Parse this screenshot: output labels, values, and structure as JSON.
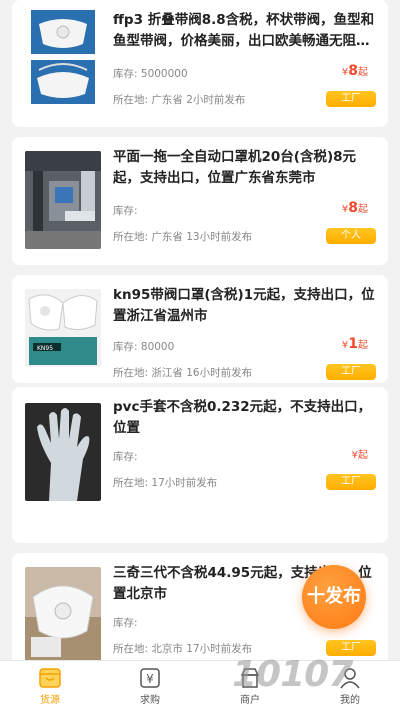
{
  "listings": [
    {
      "title": "ffp3 折叠带阀8.8含税，杯状带阀，鱼型和鱼型带阀，价格美丽，出口欧美畅通无阻…",
      "stock_label": "库存:",
      "stock_value": "5000000",
      "price_symbol": "¥",
      "price_value": "8",
      "price_suffix": "起",
      "location_label": "所在地:",
      "location_value": "广东省 2小时前发布",
      "tag": "工厂"
    },
    {
      "title": "平面一拖一全自动口罩机20台(含税)8元起，支持出口，位置广东省东莞市",
      "stock_label": "库存:",
      "stock_value": "",
      "price_symbol": "¥",
      "price_value": "8",
      "price_suffix": "起",
      "location_label": "所在地:",
      "location_value": "广东省 13小时前发布",
      "tag": "个人"
    },
    {
      "title": "kn95带阀口罩(含税)1元起，支持出口，位置浙江省温州市",
      "stock_label": "库存:",
      "stock_value": "80000",
      "price_symbol": "¥",
      "price_value": "1",
      "price_suffix": "起",
      "location_label": "所在地:",
      "location_value": "浙江省 16小时前发布",
      "tag": "工厂"
    },
    {
      "title": "pvc手套不含税0.232元起，不支持出口，位置",
      "stock_label": "库存:",
      "stock_value": "",
      "price_symbol": "¥",
      "price_value": "",
      "price_suffix": "起",
      "location_label": "所在地:",
      "location_value": "17小时前发布",
      "tag": "工厂"
    },
    {
      "title": "三奇三代不含税44.95元起，支持出口，位置北京市",
      "stock_label": "库存:",
      "stock_value": "",
      "price_symbol": "¥",
      "price_value": "",
      "price_suffix": "",
      "location_label": "所在地:",
      "location_value": "北京市 17小时前发布",
      "tag": "工厂"
    }
  ],
  "fab_label": "十发布",
  "tabs": [
    {
      "label": "货源",
      "icon": "store-icon"
    },
    {
      "label": "求购",
      "icon": "yen-icon"
    },
    {
      "label": "商户",
      "icon": "merchant-icon"
    },
    {
      "label": "我的",
      "icon": "user-icon"
    }
  ],
  "watermark": "10107"
}
